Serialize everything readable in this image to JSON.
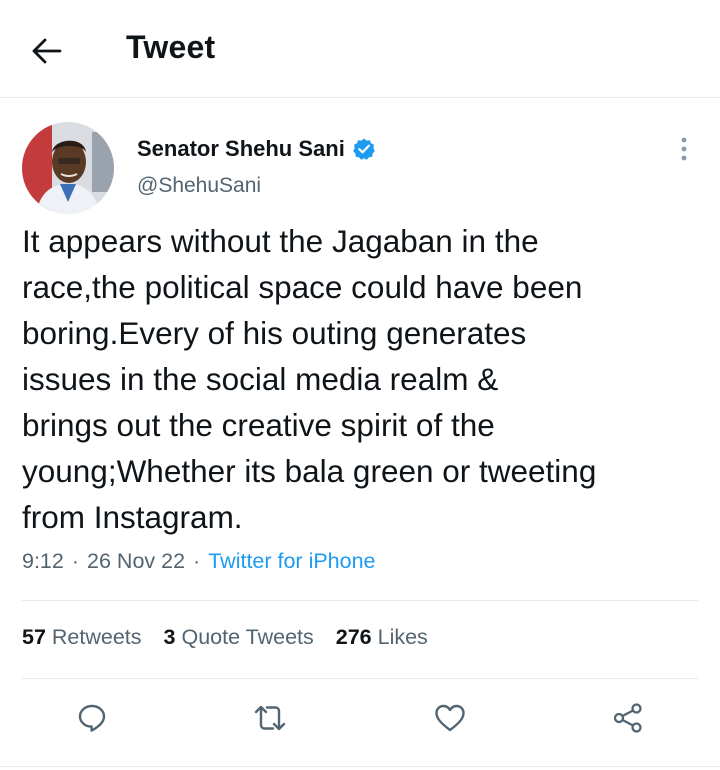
{
  "header": {
    "title": "Tweet",
    "back_icon": "arrow-left-icon"
  },
  "author": {
    "name": "Senator Shehu Sani",
    "handle": "@ShehuSani",
    "verified": true,
    "verified_color": "#1d9bf0"
  },
  "tweet": {
    "text": "It appears without the Jagaban in the\nrace,the political space could have been\nboring.Every of his outing generates\nissues in the social media realm &\nbrings out the creative spirit of the\nyoung;Whether its bala green or tweeting\nfrom Instagram.",
    "time": "9:12",
    "date": "26 Nov 22",
    "source": "Twitter for iPhone"
  },
  "stats": {
    "retweets_count": "57",
    "retweets_label": "Retweets",
    "quotes_count": "3",
    "quotes_label": "Quote Tweets",
    "likes_count": "276",
    "likes_label": "Likes"
  },
  "actions": [
    "reply-icon",
    "retweet-icon",
    "like-icon",
    "share-icon"
  ],
  "colors": {
    "accent": "#1d9bf0",
    "text": "#0f1419",
    "secondary": "#536471"
  }
}
